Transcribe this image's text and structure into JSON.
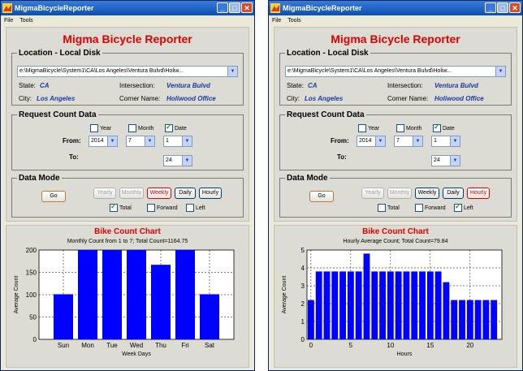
{
  "windows": [
    {
      "title": "MigmaBicycleReporter",
      "menu": [
        "File",
        "Tools"
      ],
      "app_title": "Migma Bicycle Reporter",
      "location": {
        "legend": "Location - Local Disk",
        "path": "e:\\MigmaBicycle\\System1\\CA\\Los Angeles\\Ventura Bulvd\\Holiw...",
        "state_label": "State:",
        "state": "CA",
        "city_label": "City:",
        "city": "Los Angeles",
        "intersection_label": "Intersection:",
        "intersection": "Ventura Bulvd",
        "corner_label": "Corner Name:",
        "corner": "Holiwood Office"
      },
      "request": {
        "legend": "Request Count Data",
        "year_label": "Year",
        "year_checked": false,
        "month_label": "Month",
        "month_checked": false,
        "date_label": "Date",
        "date_checked": true,
        "from_label": "From:",
        "from_year": "2014",
        "from_month": "7",
        "from_day": "1",
        "to_label": "To:",
        "to_day": "24"
      },
      "mode": {
        "legend": "Data Mode",
        "go": "Go",
        "yearly": "Yearly",
        "monthly": "Monthly",
        "weekly": "Weekly",
        "daily": "Daily",
        "hourly": "Hourly",
        "total_label": "Total",
        "total_checked": true,
        "forward_label": "Forward",
        "forward_checked": false,
        "left_label": "Left",
        "left_checked": false
      },
      "chart_data": {
        "type": "bar",
        "panel_title": "Bike Count Chart",
        "title": "Monthly Count from 1 to 7; Total Count=1164.75",
        "xlabel": "Week Days",
        "ylabel": "Average Count",
        "categories": [
          "Sun",
          "Mon",
          "Tue",
          "Wed",
          "Thu",
          "Fri",
          "Sat"
        ],
        "values": [
          101,
          200,
          200,
          200,
          167,
          200,
          101
        ],
        "ylim": [
          0,
          200
        ],
        "yticks": [
          0,
          50,
          100,
          150,
          200
        ],
        "grid": true,
        "bar_color": "#0000ff"
      }
    },
    {
      "title": "MigmaBicycleReporter",
      "menu": [
        "File",
        "Tools"
      ],
      "app_title": "Migma Bicycle Reporter",
      "location": {
        "legend": "Location - Local Disk",
        "path": "e:\\MigmaBicycle\\System1\\CA\\Los Angeles\\Ventura Bulvd\\Holiw...",
        "state_label": "State:",
        "state": "CA",
        "city_label": "City:",
        "city": "Los Angeles",
        "intersection_label": "Intersection:",
        "intersection": "Ventura Bulvd",
        "corner_label": "Corner Name:",
        "corner": "Holiwood Office"
      },
      "request": {
        "legend": "Request Count Data",
        "year_label": "Year",
        "year_checked": false,
        "month_label": "Month",
        "month_checked": false,
        "date_label": "Date",
        "date_checked": true,
        "from_label": "From:",
        "from_year": "2014",
        "from_month": "7",
        "from_day": "1",
        "to_label": "To:",
        "to_day": "24"
      },
      "mode": {
        "legend": "Data Mode",
        "go": "Go",
        "yearly": "Yearly",
        "monthly": "Monthly",
        "weekly": "Weekly",
        "daily": "Daily",
        "hourly": "Hourly",
        "total_label": "Total",
        "total_checked": false,
        "forward_label": "Forward",
        "forward_checked": false,
        "left_label": "Left",
        "left_checked": true
      },
      "chart_data": {
        "type": "bar",
        "panel_title": "Bike Count Chart",
        "title": "Hourly Average Count; Total Count=79.84",
        "xlabel": "Hours",
        "ylabel": "Average Count",
        "x": [
          0,
          1,
          2,
          3,
          4,
          5,
          6,
          7,
          8,
          9,
          10,
          11,
          12,
          13,
          14,
          15,
          16,
          17,
          18,
          19,
          20,
          21,
          22,
          23
        ],
        "values": [
          2.2,
          3.8,
          3.8,
          3.8,
          3.8,
          3.8,
          3.8,
          4.8,
          3.8,
          3.8,
          3.8,
          3.8,
          3.8,
          3.8,
          3.8,
          3.8,
          3.8,
          3.2,
          2.2,
          2.2,
          2.2,
          2.2,
          2.2,
          2.2
        ],
        "xlim": [
          -0.5,
          24
        ],
        "ylim": [
          0,
          5
        ],
        "xticks": [
          0,
          5,
          10,
          15,
          20
        ],
        "yticks": [
          0,
          1,
          2,
          3,
          4,
          5
        ],
        "grid": true,
        "bar_color": "#0000ff"
      }
    }
  ]
}
